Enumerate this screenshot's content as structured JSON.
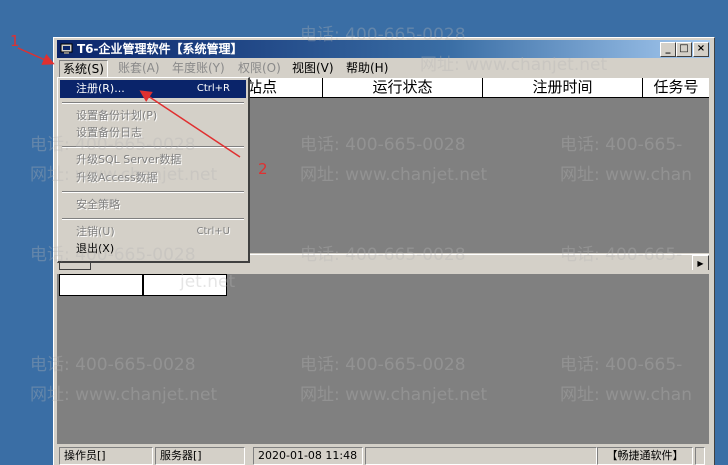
{
  "window": {
    "title": "T6-企业管理软件【系统管理】",
    "min_glyph": "_",
    "max_glyph": "□",
    "close_glyph": "×"
  },
  "menubar": [
    {
      "label": "系统(S)",
      "state": "open"
    },
    {
      "label": "账套(A)",
      "state": "disabled"
    },
    {
      "label": "年度账(Y)",
      "state": "disabled"
    },
    {
      "label": "权限(O)",
      "state": "disabled"
    },
    {
      "label": "视图(V)",
      "state": "enabled"
    },
    {
      "label": "帮助(H)",
      "state": "enabled"
    }
  ],
  "table_columns": [
    "站点",
    "运行状态",
    "注册时间",
    "任务号"
  ],
  "dropdown": {
    "items": [
      {
        "label": "注册(R)...",
        "shortcut": "Ctrl+R",
        "state": "highlighted"
      },
      {
        "label": "设置备份计划(P)",
        "shortcut": "",
        "state": "disabled"
      },
      {
        "label": "设置备份日志",
        "shortcut": "",
        "state": "disabled"
      },
      {
        "label": "升级SQL Server数据",
        "shortcut": "",
        "state": "disabled"
      },
      {
        "label": "升级Access数据",
        "shortcut": "",
        "state": "disabled"
      },
      {
        "label": "安全策略",
        "shortcut": "",
        "state": "disabled"
      },
      {
        "label": "注销(U)",
        "shortcut": "Ctrl+U",
        "state": "disabled"
      },
      {
        "label": "退出(X)",
        "shortcut": "",
        "state": "enabled"
      }
    ]
  },
  "statusbar": {
    "operator": "操作员[]",
    "server": "服务器[]",
    "datetime": "2020-01-08 11:48",
    "product": "【畅捷通软件】"
  },
  "watermark": {
    "phone": "电话: 400-665-0028",
    "site": "网址: www.chanjet.net",
    "phone_partial": "电话: 400-665-",
    "site_partial": "网址: www.chan",
    "site_fragment": "jet.net"
  },
  "annotations": {
    "step1": "1",
    "step2": "2",
    "color": "#e03030"
  }
}
